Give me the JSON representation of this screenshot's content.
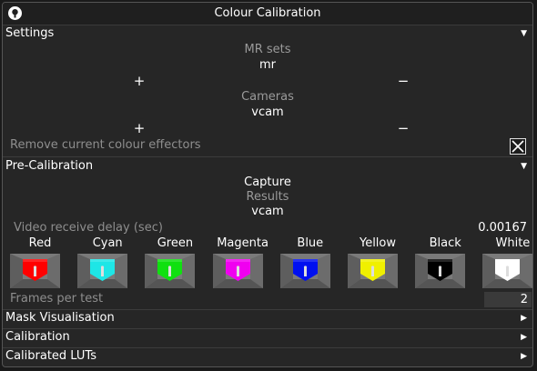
{
  "window": {
    "title": "Colour Calibration"
  },
  "settings": {
    "header": "Settings",
    "mr_sets_label": "MR sets",
    "mr_sets_value": "mr",
    "cameras_label": "Cameras",
    "cameras_value": "vcam",
    "plus": "+",
    "minus": "−",
    "remove_effectors_label": "Remove current colour effectors"
  },
  "pre_calibration": {
    "header": "Pre-Calibration",
    "capture_label": "Capture",
    "results_label": "Results",
    "results_value": "vcam",
    "delay_label": "Video receive delay (sec)",
    "delay_value": "0.00167",
    "colours": [
      {
        "name": "Red",
        "hex": "#ff0000"
      },
      {
        "name": "Cyan",
        "hex": "#1ee6e6"
      },
      {
        "name": "Green",
        "hex": "#10e010"
      },
      {
        "name": "Magenta",
        "hex": "#f000f0"
      },
      {
        "name": "Blue",
        "hex": "#0010f0"
      },
      {
        "name": "Yellow",
        "hex": "#f0f000"
      },
      {
        "name": "Black",
        "hex": "#000000"
      },
      {
        "name": "White",
        "hex": "#ffffff"
      }
    ],
    "frames_label": "Frames per test",
    "frames_value": "2"
  },
  "collapsed_sections": [
    {
      "label": "Mask Visualisation"
    },
    {
      "label": "Calibration"
    },
    {
      "label": "Calibrated LUTs"
    }
  ],
  "icons": {
    "expanded_arrow": "▼",
    "collapsed_arrow": "▶"
  }
}
